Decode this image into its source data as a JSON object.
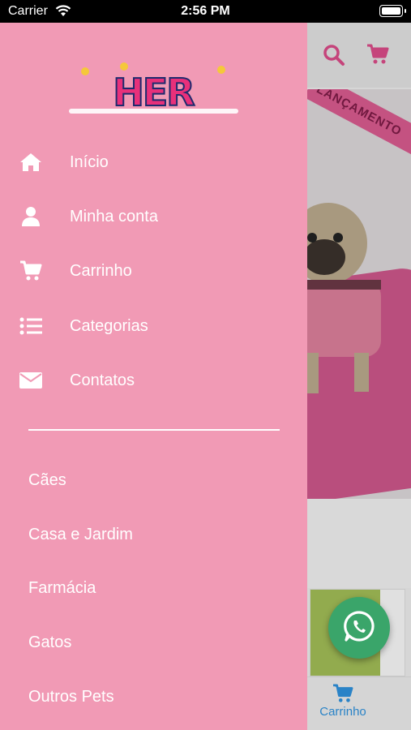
{
  "status_bar": {
    "carrier": "Carrier",
    "time": "2:56 PM"
  },
  "background": {
    "banner_ribbon": "LANÇAMENTO",
    "tab_cart_label": "Carrinho",
    "accent_color": "#d64a86",
    "tab_active_color": "#2e8fd8"
  },
  "drawer": {
    "logo_alt": "HerDog",
    "bg_color": "#f19ab5",
    "menu": [
      {
        "label": "Início",
        "icon": "home-icon"
      },
      {
        "label": "Minha conta",
        "icon": "user-icon"
      },
      {
        "label": "Carrinho",
        "icon": "cart-icon"
      },
      {
        "label": "Categorias",
        "icon": "list-icon"
      },
      {
        "label": "Contatos",
        "icon": "envelope-icon"
      }
    ],
    "categories": [
      "Cães",
      "Casa e Jardim",
      "Farmácia",
      "Gatos",
      "Outros Pets"
    ]
  },
  "whatsapp": {
    "icon": "whatsapp-icon",
    "color": "#3aa56a"
  }
}
